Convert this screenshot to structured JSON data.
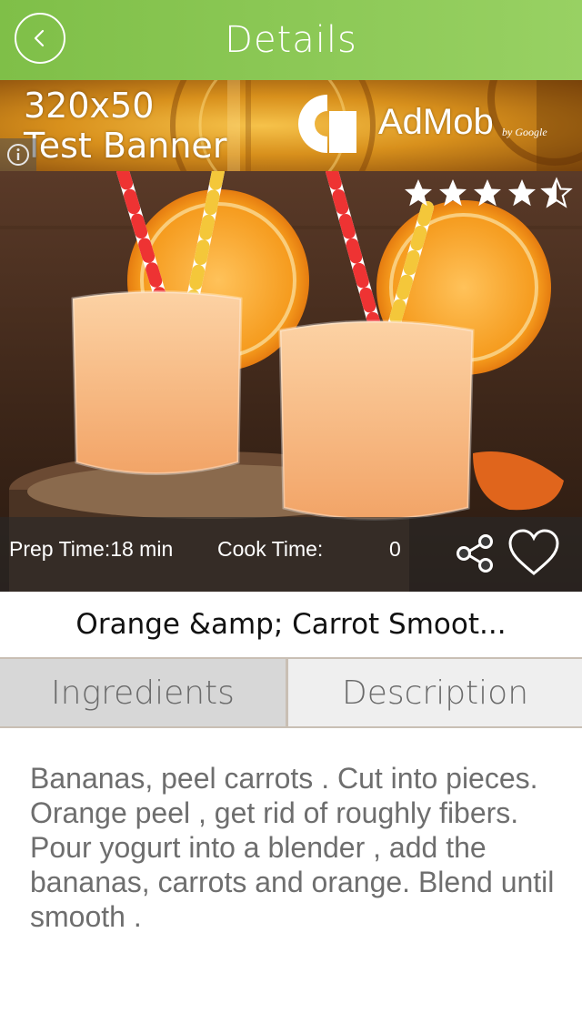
{
  "header": {
    "title": "Details",
    "back_icon": "chevron-left-icon",
    "background_color": "#8cc653"
  },
  "ad": {
    "size_label": "320x50",
    "test_label": "Test Banner",
    "brand": "AdMob",
    "by_google": "by Google",
    "info_icon": "info-icon"
  },
  "recipe": {
    "title": "Orange &amp; Carrot Smoot...",
    "rating": 4.5,
    "rating_max": 5,
    "prep_time_label": "Prep Time:18 min",
    "cook_time_label": "Cook Time:",
    "cook_time_value": "0",
    "share_icon": "share-icon",
    "favorite_icon": "heart-icon"
  },
  "tabs": [
    {
      "label": "Ingredients",
      "active": true
    },
    {
      "label": "Description",
      "active": false
    }
  ],
  "content": {
    "text": "Bananas, peel carrots . Cut into pieces. Orange peel , get rid of roughly fibers. Pour yogurt into a blender , add the bananas, carrots and orange. Blend until smooth ."
  }
}
